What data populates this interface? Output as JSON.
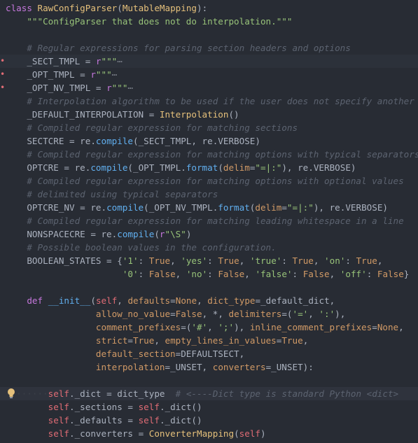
{
  "lines": [
    [
      [
        "kw",
        "class "
      ],
      [
        "cls",
        "RawConfigParser"
      ],
      [
        "",
        "("
      ],
      [
        "cls",
        "MutableMapping"
      ],
      [
        "",
        "):"
      ]
    ],
    [
      [
        "",
        "    "
      ],
      [
        "str",
        "\"\"\"ConfigParser that does not do interpolation.\"\"\""
      ]
    ],
    [],
    [
      [
        "",
        "    "
      ],
      [
        "cm",
        "# Regular expressions for parsing section headers and options"
      ]
    ],
    [
      [
        "",
        "    _SECT_TMPL = "
      ],
      [
        "kw",
        "r"
      ],
      [
        "str",
        "\"\"\""
      ],
      [
        "fold",
        "⋯"
      ]
    ],
    [
      [
        "",
        "    _OPT_TMPL = "
      ],
      [
        "kw",
        "r"
      ],
      [
        "str",
        "\"\"\""
      ],
      [
        "fold",
        "⋯"
      ]
    ],
    [
      [
        "",
        "    _OPT_NV_TMPL = "
      ],
      [
        "kw",
        "r"
      ],
      [
        "str",
        "\"\"\""
      ],
      [
        "fold",
        "⋯"
      ]
    ],
    [
      [
        "",
        "    "
      ],
      [
        "cm",
        "# Interpolation algorithm to be used if the user does not specify another"
      ]
    ],
    [
      [
        "",
        "    _DEFAULT_INTERPOLATION = "
      ],
      [
        "cls",
        "Interpolation"
      ],
      [
        "",
        "()"
      ]
    ],
    [
      [
        "",
        "    "
      ],
      [
        "cm",
        "# Compiled regular expression for matching sections"
      ]
    ],
    [
      [
        "",
        "    SECTCRE = re."
      ],
      [
        "fn",
        "compile"
      ],
      [
        "",
        "(_SECT_TMPL, re.VERBOSE)"
      ]
    ],
    [
      [
        "",
        "    "
      ],
      [
        "cm",
        "# Compiled regular expression for matching options with typical separators"
      ]
    ],
    [
      [
        "",
        "    OPTCRE = re."
      ],
      [
        "fn",
        "compile"
      ],
      [
        "",
        "(_OPT_TMPL."
      ],
      [
        "fn",
        "format"
      ],
      [
        "",
        "("
      ],
      [
        "par",
        "delim"
      ],
      [
        "",
        "="
      ],
      [
        "str",
        "\"=|:\""
      ],
      [
        "",
        "), re.VERBOSE)"
      ]
    ],
    [
      [
        "",
        "    "
      ],
      [
        "cm",
        "# Compiled regular expression for matching options with optional values"
      ]
    ],
    [
      [
        "",
        "    "
      ],
      [
        "cm",
        "# delimited using typical separators"
      ]
    ],
    [
      [
        "",
        "    OPTCRE_NV = re."
      ],
      [
        "fn",
        "compile"
      ],
      [
        "",
        "(_OPT_NV_TMPL."
      ],
      [
        "fn",
        "format"
      ],
      [
        "",
        "("
      ],
      [
        "par",
        "delim"
      ],
      [
        "",
        "="
      ],
      [
        "str",
        "\"=|:\""
      ],
      [
        "",
        "), re.VERBOSE)"
      ]
    ],
    [
      [
        "",
        "    "
      ],
      [
        "cm",
        "# Compiled regular expression for matching leading whitespace in a line"
      ]
    ],
    [
      [
        "",
        "    NONSPACECRE = re."
      ],
      [
        "fn",
        "compile"
      ],
      [
        "",
        "("
      ],
      [
        "kw",
        "r"
      ],
      [
        "str",
        "\"\\S\""
      ],
      [
        "",
        ")"
      ]
    ],
    [
      [
        "",
        "    "
      ],
      [
        "cm",
        "# Possible boolean values in the configuration."
      ]
    ],
    [
      [
        "",
        "    BOOLEAN_STATES = {"
      ],
      [
        "str",
        "'1'"
      ],
      [
        "",
        ": "
      ],
      [
        "num",
        "True"
      ],
      [
        "",
        ", "
      ],
      [
        "str",
        "'yes'"
      ],
      [
        "",
        ": "
      ],
      [
        "num",
        "True"
      ],
      [
        "",
        ", "
      ],
      [
        "str",
        "'true'"
      ],
      [
        "",
        ": "
      ],
      [
        "num",
        "True"
      ],
      [
        "",
        ", "
      ],
      [
        "str",
        "'on'"
      ],
      [
        "",
        ": "
      ],
      [
        "num",
        "True"
      ],
      [
        "",
        ","
      ]
    ],
    [
      [
        "",
        "                      "
      ],
      [
        "str",
        "'0'"
      ],
      [
        "",
        ": "
      ],
      [
        "num",
        "False"
      ],
      [
        "",
        ", "
      ],
      [
        "str",
        "'no'"
      ],
      [
        "",
        ": "
      ],
      [
        "num",
        "False"
      ],
      [
        "",
        ", "
      ],
      [
        "str",
        "'false'"
      ],
      [
        "",
        ": "
      ],
      [
        "num",
        "False"
      ],
      [
        "",
        ", "
      ],
      [
        "str",
        "'off'"
      ],
      [
        "",
        ": "
      ],
      [
        "num",
        "False"
      ],
      [
        "",
        "}"
      ]
    ],
    [],
    [
      [
        "",
        "    "
      ],
      [
        "kw",
        "def "
      ],
      [
        "fn",
        "__init__"
      ],
      [
        "",
        "("
      ],
      [
        "slf",
        "self"
      ],
      [
        "",
        ", "
      ],
      [
        "par",
        "defaults"
      ],
      [
        "",
        "="
      ],
      [
        "num",
        "None"
      ],
      [
        "",
        ", "
      ],
      [
        "par",
        "dict_type"
      ],
      [
        "",
        "=_default_dict,"
      ]
    ],
    [
      [
        "",
        "                 "
      ],
      [
        "par",
        "allow_no_value"
      ],
      [
        "",
        "="
      ],
      [
        "num",
        "False"
      ],
      [
        "",
        ", *, "
      ],
      [
        "par",
        "delimiters"
      ],
      [
        "",
        "=("
      ],
      [
        "str",
        "'='"
      ],
      [
        "",
        ", "
      ],
      [
        "str",
        "':'"
      ],
      [
        "",
        "),"
      ]
    ],
    [
      [
        "",
        "                 "
      ],
      [
        "par",
        "comment_prefixes"
      ],
      [
        "",
        "=("
      ],
      [
        "str",
        "'#'"
      ],
      [
        "",
        ", "
      ],
      [
        "str",
        "';'"
      ],
      [
        "",
        "), "
      ],
      [
        "par",
        "inline_comment_prefixes"
      ],
      [
        "",
        "="
      ],
      [
        "num",
        "None"
      ],
      [
        "",
        ","
      ]
    ],
    [
      [
        "",
        "                 "
      ],
      [
        "par",
        "strict"
      ],
      [
        "",
        "="
      ],
      [
        "num",
        "True"
      ],
      [
        "",
        ", "
      ],
      [
        "par",
        "empty_lines_in_values"
      ],
      [
        "",
        "="
      ],
      [
        "num",
        "True"
      ],
      [
        "",
        ","
      ]
    ],
    [
      [
        "",
        "                 "
      ],
      [
        "par",
        "default_section"
      ],
      [
        "",
        "=DEFAULTSECT,"
      ]
    ],
    [
      [
        "",
        "                 "
      ],
      [
        "par",
        "interpolation"
      ],
      [
        "",
        "=_UNSET, "
      ],
      [
        "par",
        "converters"
      ],
      [
        "",
        "=_UNSET):"
      ]
    ],
    [],
    [
      [
        "ws",
        "········"
      ],
      [
        "slf",
        "self"
      ],
      [
        "",
        "._dict = dict_type  "
      ],
      [
        "cm",
        "# <----Dict type is standard Python <dict>"
      ]
    ],
    [
      [
        "",
        "        "
      ],
      [
        "slf",
        "self"
      ],
      [
        "",
        "._sections = "
      ],
      [
        "slf",
        "self"
      ],
      [
        "",
        "._dict()"
      ]
    ],
    [
      [
        "",
        "        "
      ],
      [
        "slf",
        "self"
      ],
      [
        "",
        "._defaults = "
      ],
      [
        "slf",
        "self"
      ],
      [
        "",
        "._dict()"
      ]
    ],
    [
      [
        "",
        "        "
      ],
      [
        "slf",
        "self"
      ],
      [
        "",
        "._converters = "
      ],
      [
        "cls",
        "ConverterMapping"
      ],
      [
        "",
        "("
      ],
      [
        "slf",
        "self"
      ],
      [
        "",
        ")"
      ]
    ]
  ],
  "markers": {
    "folded_lines": [
      4,
      5,
      6
    ],
    "highlighted_lines": [
      4
    ],
    "current_line": 29,
    "lightbulb_line": 29
  },
  "colors": {
    "background": "#282c34",
    "keyword": "#c678dd",
    "class": "#e5c07b",
    "function": "#61afef",
    "string": "#98c379",
    "comment": "#5c6370",
    "self": "#e06c75",
    "constant": "#d19a66"
  },
  "icons": {
    "lightbulb": "lightbulb-icon"
  }
}
